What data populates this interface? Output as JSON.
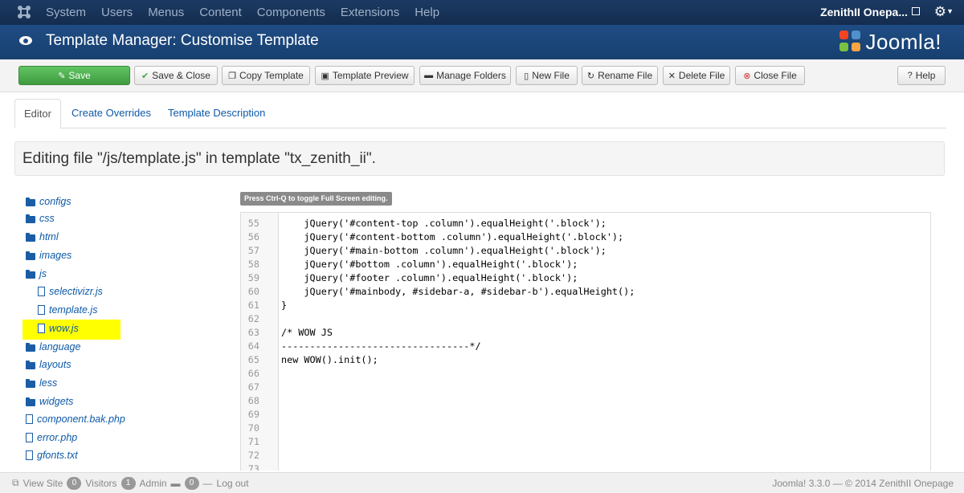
{
  "topnav": {
    "menu": [
      "System",
      "Users",
      "Menus",
      "Content",
      "Components",
      "Extensions",
      "Help"
    ],
    "site_name": "ZenithII Onepa..."
  },
  "header": {
    "title": "Template Manager: Customise Template",
    "brand": "Joomla!"
  },
  "toolbar": {
    "save": "Save",
    "save_close": "Save & Close",
    "copy_template": "Copy Template",
    "template_preview": "Template Preview",
    "manage_folders": "Manage Folders",
    "new_file": "New File",
    "rename_file": "Rename File",
    "delete_file": "Delete File",
    "close_file": "Close File",
    "help": "Help"
  },
  "tabs": [
    "Editor",
    "Create Overrides",
    "Template Description"
  ],
  "editing_message": "Editing file \"/js/template.js\" in template \"tx_zenith_ii\".",
  "tree": [
    {
      "type": "folder",
      "label": "configs"
    },
    {
      "type": "folder",
      "label": "css"
    },
    {
      "type": "folder",
      "label": "html"
    },
    {
      "type": "folder",
      "label": "images"
    },
    {
      "type": "folder",
      "label": "js"
    },
    {
      "type": "file",
      "label": "selectivizr.js"
    },
    {
      "type": "file",
      "label": "template.js"
    },
    {
      "type": "file",
      "label": "wow.js"
    },
    {
      "type": "folder",
      "label": "language"
    },
    {
      "type": "folder",
      "label": "layouts"
    },
    {
      "type": "folder",
      "label": "less"
    },
    {
      "type": "folder",
      "label": "widgets"
    },
    {
      "type": "file",
      "label": "component.bak.php"
    },
    {
      "type": "file",
      "label": "error.php"
    },
    {
      "type": "file",
      "label": "gfonts.txt"
    }
  ],
  "editor": {
    "hint": "Press Ctrl-Q to toggle Full Screen editing.",
    "lines": [
      {
        "n": "55",
        "code": "    jQuery('#content-top .column').equalHeight('.block');"
      },
      {
        "n": "56",
        "code": "    jQuery('#content-bottom .column').equalHeight('.block');"
      },
      {
        "n": "57",
        "code": "    jQuery('#main-bottom .column').equalHeight('.block');"
      },
      {
        "n": "58",
        "code": "    jQuery('#bottom .column').equalHeight('.block');"
      },
      {
        "n": "59",
        "code": "    jQuery('#footer .column').equalHeight('.block');"
      },
      {
        "n": "60",
        "code": "    jQuery('#mainbody, #sidebar-a, #sidebar-b').equalHeight();"
      },
      {
        "n": "61",
        "code": "}"
      },
      {
        "n": "62",
        "code": ""
      },
      {
        "n": "63",
        "code": "/* WOW JS"
      },
      {
        "n": "64",
        "code": "---------------------------------*/"
      },
      {
        "n": "65",
        "code": "new WOW().init();"
      },
      {
        "n": "66",
        "code": ""
      },
      {
        "n": "67",
        "code": ""
      },
      {
        "n": "68",
        "code": ""
      },
      {
        "n": "69",
        "code": ""
      },
      {
        "n": "70",
        "code": ""
      },
      {
        "n": "71",
        "code": ""
      },
      {
        "n": "72",
        "code": ""
      },
      {
        "n": "73",
        "code": ""
      }
    ]
  },
  "status": {
    "view_site": "View Site",
    "visitors_count": "0",
    "visitors": "Visitors",
    "admin_count": "1",
    "admin": "Admin",
    "messages_count": "0",
    "logout": "Log out",
    "footer": "Joomla! 3.3.0 — © 2014 ZenithII Onepage"
  }
}
